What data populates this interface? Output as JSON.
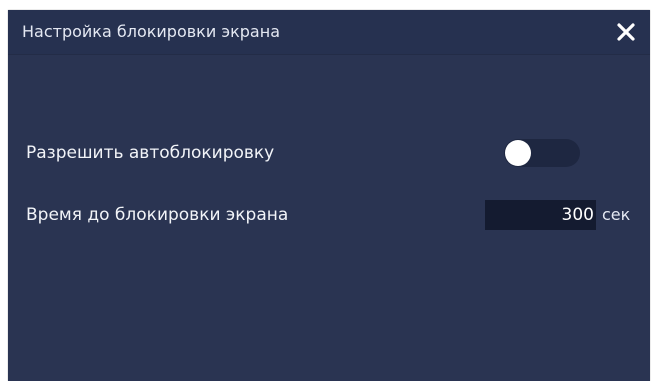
{
  "dialog": {
    "title": "Настройка блокировки экрана",
    "close_icon": "close-icon",
    "colors": {
      "background": "#2a3452",
      "titlebar": "#263150",
      "input_background": "#141b30",
      "toggle_track": "#1e2741",
      "toggle_knob": "#ffffff"
    }
  },
  "auto_lock": {
    "label": "Разрешить автоблокировку",
    "enabled": false
  },
  "lock_time": {
    "label": "Время до блокировки экрана",
    "value": "300",
    "unit": "сек"
  }
}
